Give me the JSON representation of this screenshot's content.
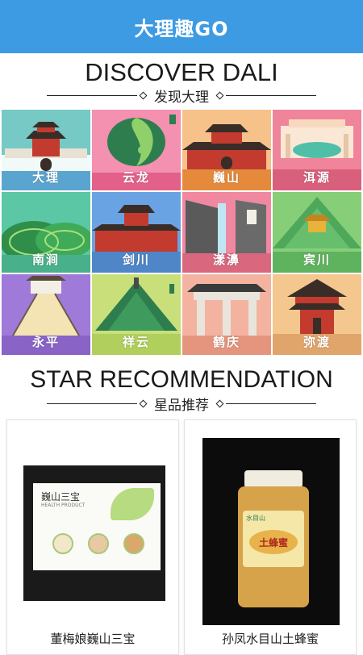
{
  "app": {
    "title": "大理趣GO"
  },
  "discover": {
    "title": "DISCOVER DALI",
    "subtitle": "发现大理"
  },
  "destinations": [
    {
      "label": "大理",
      "bg": "#76c9c4",
      "scene": "gate-wall"
    },
    {
      "label": "云龙",
      "bg": "#f490b0",
      "scene": "taiji-hill"
    },
    {
      "label": "巍山",
      "bg": "#f6c28a",
      "scene": "red-tower"
    },
    {
      "label": "洱源",
      "bg": "#f0849a",
      "scene": "hall-pool"
    },
    {
      "label": "南涧",
      "bg": "#5bc7a4",
      "scene": "tea-hills"
    },
    {
      "label": "剑川",
      "bg": "#6aa3e3",
      "scene": "old-town"
    },
    {
      "label": "漾濞",
      "bg": "#f088a2",
      "scene": "waterfall-cliff"
    },
    {
      "label": "宾川",
      "bg": "#86cf78",
      "scene": "temple-peak"
    },
    {
      "label": "永平",
      "bg": "#a07ad8",
      "scene": "chain-bridge"
    },
    {
      "label": "祥云",
      "bg": "#c9e07a",
      "scene": "pagoda-hill"
    },
    {
      "label": "鹤庆",
      "bg": "#f3b3a0",
      "scene": "archway"
    },
    {
      "label": "弥渡",
      "bg": "#f4c78f",
      "scene": "pavilion"
    }
  ],
  "recommend": {
    "title": "STAR RECOMMENDATION",
    "subtitle": "星品推荐"
  },
  "products": [
    {
      "name": "董梅娘巍山三宝",
      "box_title": "巍山三宝",
      "box_sub": "HEALTH PRODUCT",
      "accent": "#7fbf3a"
    },
    {
      "name": "孙凤水目山土蜂蜜",
      "jar_label": "土蜂蜜",
      "jar_brand": "水目山",
      "accent": "#d6a24a"
    }
  ],
  "colors": {
    "header": "#3d9be3"
  }
}
